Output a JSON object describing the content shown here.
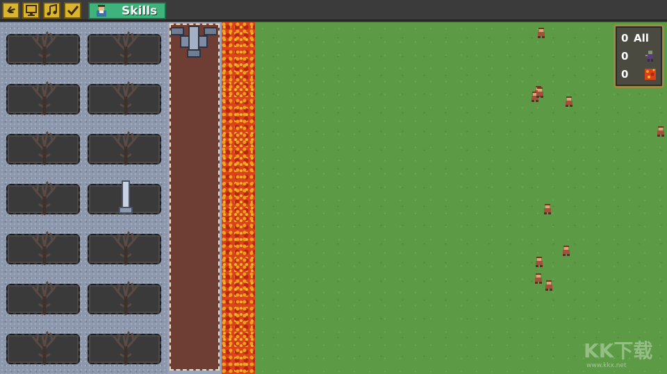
{
  "toolbar": {
    "buttons": [
      {
        "icon": "hand-pointer-icon"
      },
      {
        "icon": "monitor-icon"
      },
      {
        "icon": "music-note-icon"
      },
      {
        "icon": "checkmark-icon"
      }
    ],
    "skills_tab": {
      "label": "Skills",
      "icon": "player-portrait-icon"
    }
  },
  "graveyard": {
    "plots": [
      {
        "content": "dead-tree-icon"
      },
      {
        "content": "dead-tree-icon"
      },
      {
        "content": "dead-tree-icon"
      },
      {
        "content": "dead-tree-icon"
      },
      {
        "content": "dead-tree-icon"
      },
      {
        "content": "dead-tree-icon"
      },
      {
        "content": "dead-tree-icon"
      },
      {
        "content": "tombstone-obelisk-icon"
      },
      {
        "content": "dead-tree-icon"
      },
      {
        "content": "dead-tree-icon"
      },
      {
        "content": "dead-tree-icon"
      },
      {
        "content": "dead-tree-icon"
      },
      {
        "content": "dead-tree-icon"
      },
      {
        "content": "dead-tree-icon"
      }
    ]
  },
  "counter": {
    "all": {
      "value": "0",
      "label": "All"
    },
    "zombies": {
      "value": "0",
      "icon": "zombie-icon"
    },
    "lava": {
      "value": "0",
      "icon": "lava-tile-icon"
    }
  },
  "field": {
    "villagers_visible": 11
  },
  "watermark": {
    "text": "KK下载",
    "url": "www.kkx.net"
  },
  "colors": {
    "grass": "#5c9a45",
    "lava": "#d9421a",
    "road": "#6e3d34",
    "stone": "#8e98ad",
    "toolbar_button": "#d9b52e",
    "skills_tab": "#3fb37c",
    "panel_border": "#a08a42"
  }
}
